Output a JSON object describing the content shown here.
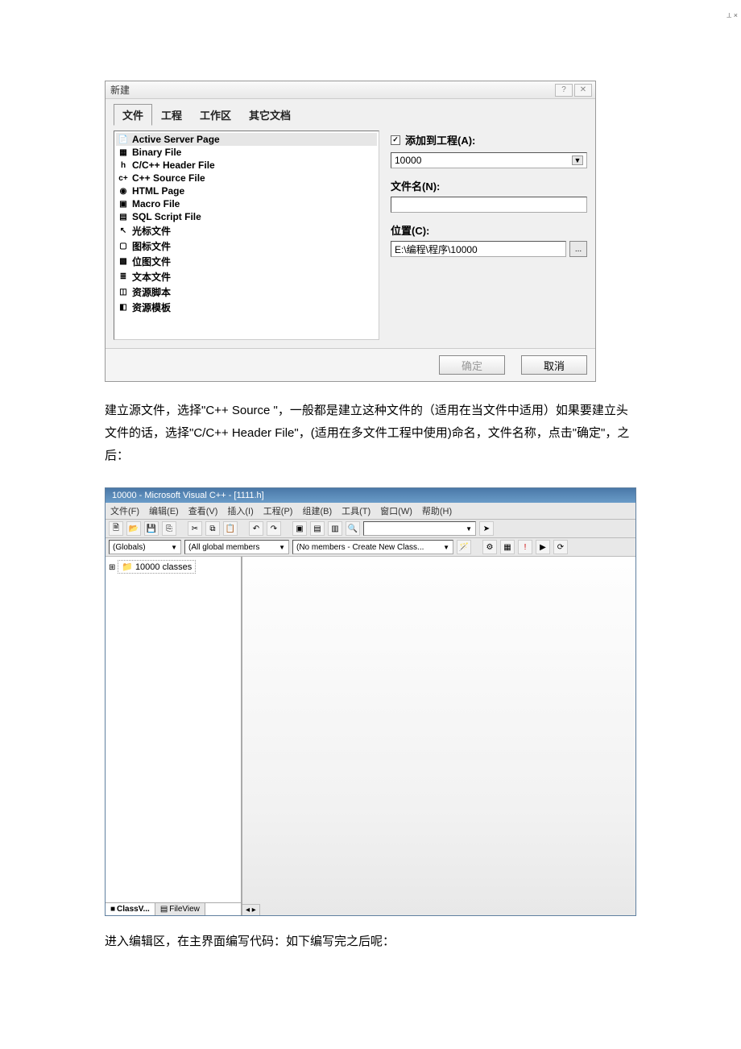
{
  "dialog": {
    "title": "新建",
    "help_btn": "?",
    "close_btn": "✕",
    "tabs": [
      "文件",
      "工程",
      "工作区",
      "其它文档"
    ],
    "active_tab": 0,
    "file_types": [
      "Active Server Page",
      "Binary File",
      "C/C++ Header File",
      "C++ Source File",
      "HTML Page",
      "Macro File",
      "SQL Script File",
      "光标文件",
      "图标文件",
      "位图文件",
      "文本文件",
      "资源脚本",
      "资源模板"
    ],
    "right": {
      "add_to_project_label": "添加到工程(A):",
      "project_value": "10000",
      "filename_label": "文件名(N):",
      "filename_value": "",
      "location_label": "位置(C):",
      "location_value": "E:\\编程\\程序\\10000",
      "browse": "..."
    },
    "footer": {
      "ok": "确定",
      "cancel": "取消"
    }
  },
  "para1": "建立源文件，选择\"C++ Source \"，一般都是建立这种文件的（适用在当文件中适用）如果要建立头文件的话，选择\"C/C++ Header File\"，(适用在多文件工程中使用)命名，文件名称，点击\"确定\"，之后：",
  "vc": {
    "window_title": "10000 - Microsoft Visual C++ - [1111.h]",
    "menus": [
      "文件(F)",
      "编辑(E)",
      "查看(V)",
      "插入(I)",
      "工程(P)",
      "组建(B)",
      "工具(T)",
      "窗口(W)",
      "帮助(H)"
    ],
    "combo_globals": "(Globals)",
    "combo_members": "(All global members",
    "combo_newclass": "(No members - Create New Class...",
    "tree_root": "10000 classes",
    "side_tabs": {
      "classv": "ClassV...",
      "fileview": "FileView"
    }
  },
  "para2": "进入编辑区，在主界面编写代码：如下编写完之后呢："
}
